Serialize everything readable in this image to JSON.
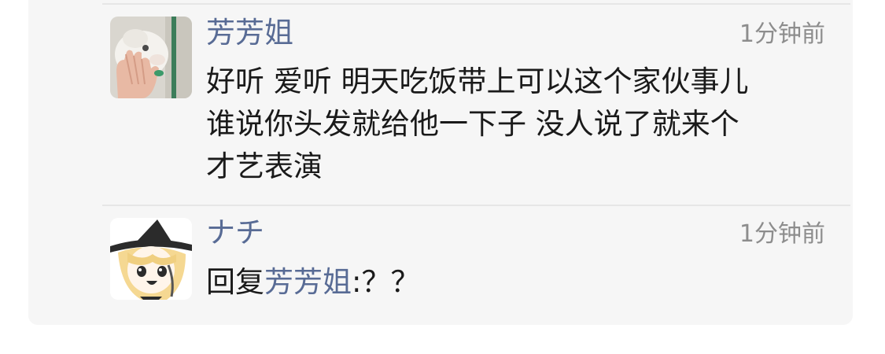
{
  "comments": [
    {
      "username": "芳芳姐",
      "time": "1分钟前",
      "avatar_icon": "white-cat-avatar-icon",
      "content_lines": [
        "好听 爱听 明天吃饭带上可以这个家伙事儿",
        "谁说你头发就给他一下子 没人说了就来个",
        "才艺表演"
      ]
    },
    {
      "username": "ナチ",
      "time": "1分钟前",
      "avatar_icon": "anime-witch-avatar-icon",
      "reply_prefix": "回复",
      "reply_to": "芳芳姐",
      "reply_text": ":？？"
    }
  ],
  "colors": {
    "username": "#586b95",
    "time": "#8d8d8d",
    "text": "#1a1a1a",
    "panel_bg": "#f6f6f6",
    "divider": "#e6e6e6"
  }
}
